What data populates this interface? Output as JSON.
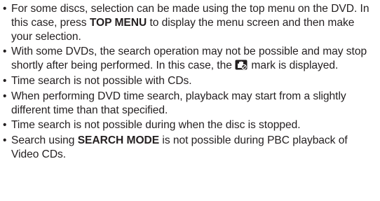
{
  "notes": [
    {
      "bullet": "•",
      "before": "For some discs, selection can be made using the top menu on the DVD. In this case, press ",
      "key": "TOP MENU",
      "after": " to display the menu screen and then make your selection."
    },
    {
      "bullet": "•",
      "before": "With some DVDs, the search operation may not be possible and may stop shortly after being performed. In this case, the ",
      "icon": "prohibited-hand-icon",
      "after": " mark is displayed."
    },
    {
      "bullet": "•",
      "text": "Time search is not possible with CDs."
    },
    {
      "bullet": "•",
      "text": "When performing DVD time search, playback may start from a slightly different time than that specified."
    },
    {
      "bullet": "•",
      "text": "Time search is not possible during when the disc is stopped."
    },
    {
      "bullet": "•",
      "before": "Search using ",
      "key": "SEARCH MODE",
      "after": " is not possible during PBC playback of Video CDs."
    }
  ]
}
